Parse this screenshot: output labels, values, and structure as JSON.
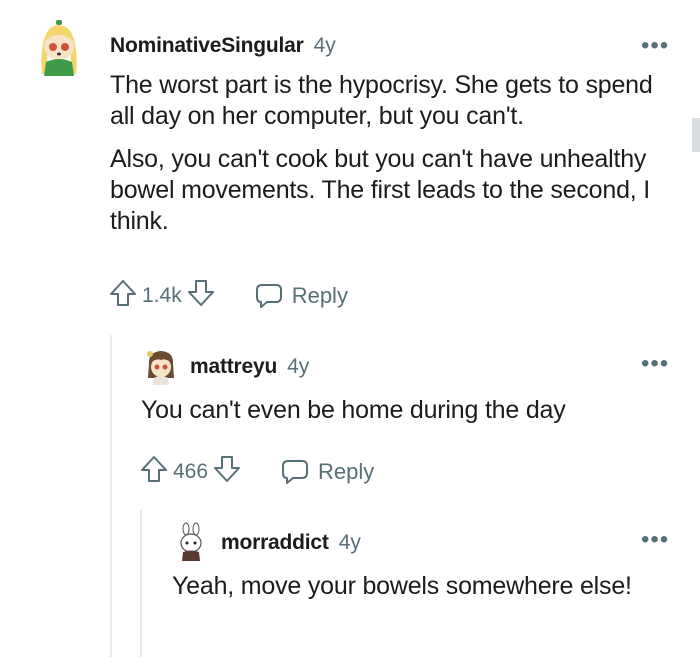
{
  "comments": [
    {
      "username": "NominativeSingular",
      "age": "4y",
      "paragraphs": [
        "The worst part is the hypocrisy. She gets to spend all day on her computer, but you can't.",
        "Also, you can't cook but you can't have unhealthy bowel movements. The first leads to the second, I think."
      ],
      "votes": "1.4k",
      "reply_label": "Reply",
      "more_label": "•••",
      "avatar_icon": "snoo-avatar-blonde-green-icon"
    },
    {
      "username": "mattreyu",
      "age": "4y",
      "paragraphs": [
        "You can't even be home during the day"
      ],
      "votes": "466",
      "reply_label": "Reply",
      "more_label": "•••",
      "avatar_icon": "snoo-avatar-brown-hair-icon"
    },
    {
      "username": "morraddict",
      "age": "4y",
      "paragraphs": [
        "Yeah, move your bowels somewhere else!"
      ],
      "more_label": "•••",
      "avatar_icon": "snoo-avatar-bunny-ears-icon"
    }
  ],
  "icons": {
    "upvote": "upvote-arrow-icon",
    "downvote": "downvote-arrow-icon",
    "reply": "speech-bubble-icon",
    "more": "more-options-icon"
  },
  "colors": {
    "text": "#1c1c1c",
    "meta": "#576f76",
    "thread_line": "#e5ebee",
    "avatar1_green": "#3f9a4a",
    "avatar1_hair": "#f2d66b"
  }
}
